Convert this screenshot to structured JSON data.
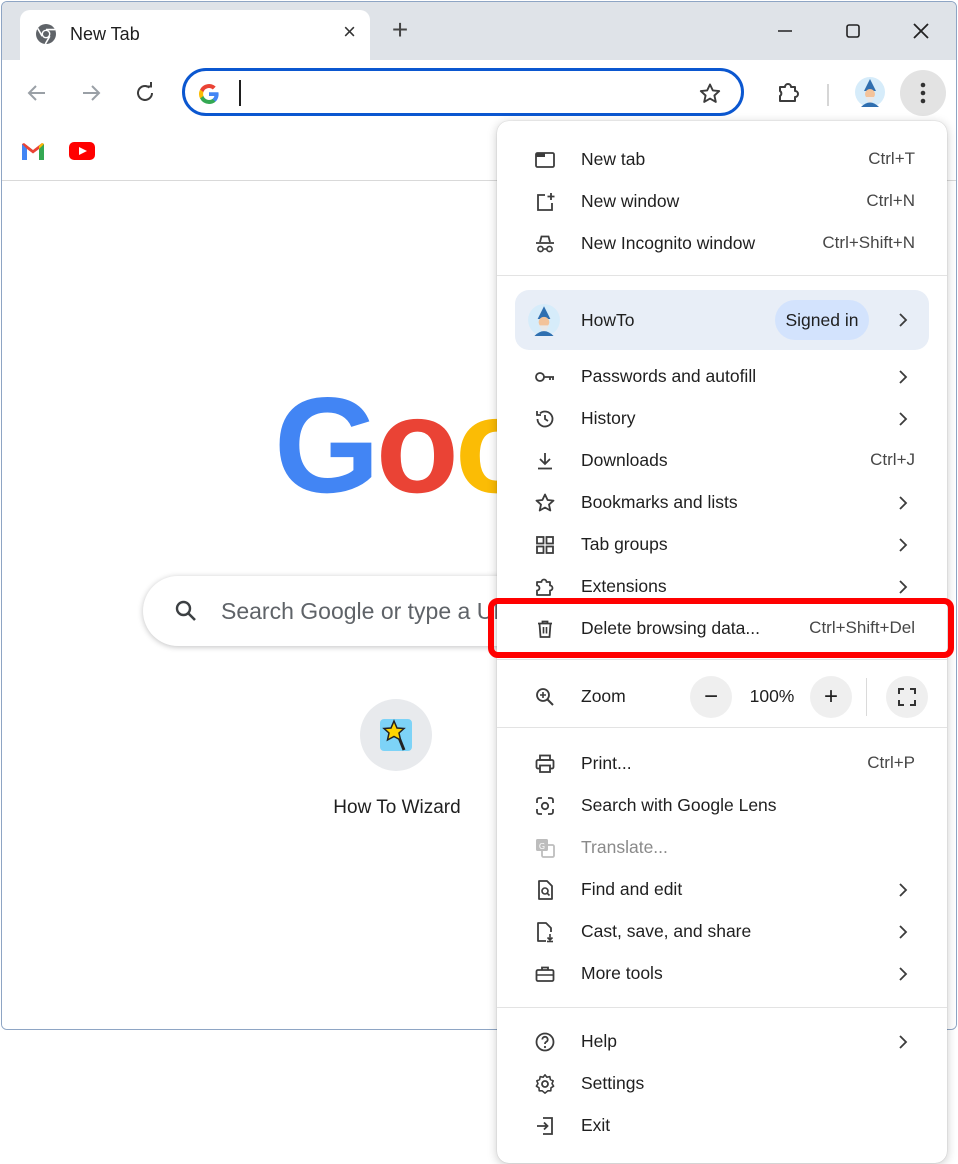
{
  "tab": {
    "title": "New Tab",
    "close": "×"
  },
  "toolbar": {
    "new_tab": "+",
    "omnibox_value": ""
  },
  "page": {
    "logo_letters": [
      "G",
      "o",
      "o"
    ],
    "search_placeholder": "Search Google or type a URL",
    "shortcut_label": "How To Wizard"
  },
  "menu": {
    "group1": [
      {
        "label": "New tab",
        "shortcut": "Ctrl+T",
        "icon": "new-tab-icon"
      },
      {
        "label": "New window",
        "shortcut": "Ctrl+N",
        "icon": "new-window-icon"
      },
      {
        "label": "New Incognito window",
        "shortcut": "Ctrl+Shift+N",
        "icon": "incognito-icon"
      }
    ],
    "profile": {
      "name": "HowTo",
      "status": "Signed in"
    },
    "group2": [
      {
        "label": "Passwords and autofill",
        "icon": "key-icon"
      },
      {
        "label": "History",
        "icon": "history-icon"
      },
      {
        "label": "Downloads",
        "shortcut": "Ctrl+J",
        "icon": "download-icon"
      },
      {
        "label": "Bookmarks and lists",
        "icon": "star-icon"
      },
      {
        "label": "Tab groups",
        "icon": "tab-groups-icon"
      },
      {
        "label": "Extensions",
        "icon": "extension-icon"
      },
      {
        "label": "Delete browsing data...",
        "shortcut": "Ctrl+Shift+Del",
        "icon": "trash-icon"
      }
    ],
    "zoom": {
      "label": "Zoom",
      "minus": "−",
      "value": "100%",
      "plus": "+"
    },
    "group3": [
      {
        "label": "Print...",
        "shortcut": "Ctrl+P",
        "icon": "print-icon"
      },
      {
        "label": "Search with Google Lens",
        "icon": "lens-icon"
      },
      {
        "label": "Translate...",
        "icon": "translate-icon"
      },
      {
        "label": "Find and edit",
        "icon": "find-icon"
      },
      {
        "label": "Cast, save, and share",
        "icon": "cast-save-icon"
      },
      {
        "label": "More tools",
        "icon": "toolbox-icon"
      }
    ],
    "group4": [
      {
        "label": "Help",
        "icon": "help-icon"
      },
      {
        "label": "Settings",
        "icon": "gear-icon"
      },
      {
        "label": "Exit",
        "icon": "exit-icon"
      }
    ]
  },
  "colors": {
    "accent": "#0b57d0",
    "highlight": "#ff0000",
    "google_blue": "#4285f4",
    "google_red": "#ea4335",
    "google_yellow": "#fbbc05"
  }
}
